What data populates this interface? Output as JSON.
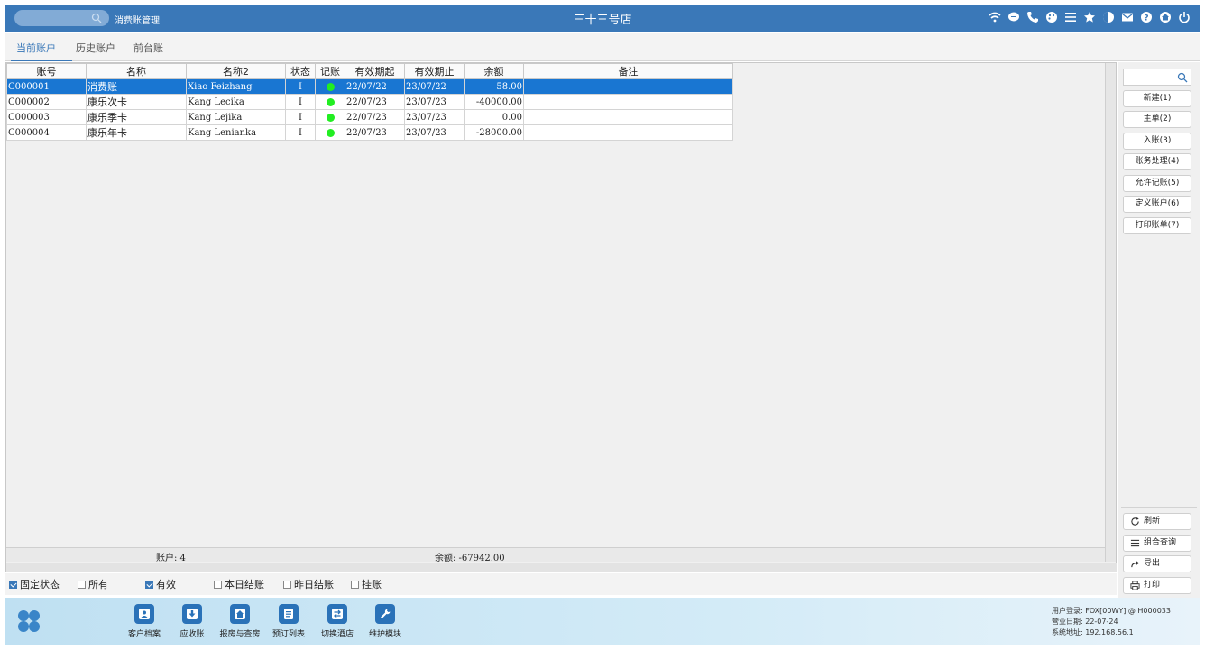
{
  "header": {
    "module_title": "消费账管理",
    "hotel_name": "三十三号店",
    "icons": [
      "wifi-icon",
      "chat-icon",
      "phone-icon",
      "palette-icon",
      "menu-icon",
      "star-icon",
      "contrast-icon",
      "mail-icon",
      "help-icon",
      "home-icon",
      "power-icon"
    ]
  },
  "tabs": [
    {
      "label": "当前账户",
      "active": true
    },
    {
      "label": "历史账户",
      "active": false
    },
    {
      "label": "前台账",
      "active": false
    }
  ],
  "table": {
    "columns": [
      "账号",
      "名称",
      "名称2",
      "状态",
      "记账",
      "有效期起",
      "有效期止",
      "余额",
      "备注"
    ],
    "rows": [
      {
        "account": "C000001",
        "name": "消费账",
        "name2": "Xiao Feizhang",
        "status": "I",
        "posting": "green",
        "start": "22/07/22",
        "end": "23/07/22",
        "balance": "58.00",
        "remark": "",
        "selected": true
      },
      {
        "account": "C000002",
        "name": "康乐次卡",
        "name2": "Kang Lecika",
        "status": "I",
        "posting": "green",
        "start": "22/07/23",
        "end": "23/07/23",
        "balance": "-40000.00",
        "remark": "",
        "selected": false
      },
      {
        "account": "C000003",
        "name": "康乐季卡",
        "name2": "Kang Lejika",
        "status": "I",
        "posting": "green",
        "start": "22/07/23",
        "end": "23/07/23",
        "balance": "0.00",
        "remark": "",
        "selected": false
      },
      {
        "account": "C000004",
        "name": "康乐年卡",
        "name2": "Kang Lenianka",
        "status": "I",
        "posting": "green",
        "start": "22/07/23",
        "end": "23/07/23",
        "balance": "-28000.00",
        "remark": "",
        "selected": false
      }
    ],
    "footer": {
      "accounts_text": "账户: 4",
      "balance_text": "余额: -67942.00"
    }
  },
  "right_panel": {
    "search_placeholder": "",
    "buttons": [
      "新建(1)",
      "主单(2)",
      "入账(3)",
      "账务处理(4)",
      "允许记账(5)",
      "定义账户(6)",
      "打印账单(7)"
    ],
    "bottom_buttons": [
      "刷新",
      "组合查询",
      "导出",
      "打印"
    ]
  },
  "filters": [
    {
      "label": "固定状态",
      "checked": true
    },
    {
      "label": "所有",
      "checked": false
    },
    {
      "label": "有效",
      "checked": true
    },
    {
      "label": "本日结账",
      "checked": false
    },
    {
      "label": "昨日结账",
      "checked": false
    },
    {
      "label": "挂账",
      "checked": false
    }
  ],
  "toolbar": {
    "items": [
      "客户档案",
      "应收账",
      "报房与查房",
      "预订列表",
      "切换酒店",
      "维护模块"
    ]
  },
  "status": {
    "user_login": "用户登录: FOX[00WY] @ H000033",
    "business_date": "营业日期: 22-07-24",
    "system_address": "系统地址: 192.168.56.1"
  },
  "colors": {
    "header_bg": "#3a78b8",
    "selected_row": "#1976d2",
    "posting_dot": "#22ee22",
    "active_tab": "#3a78b8"
  }
}
